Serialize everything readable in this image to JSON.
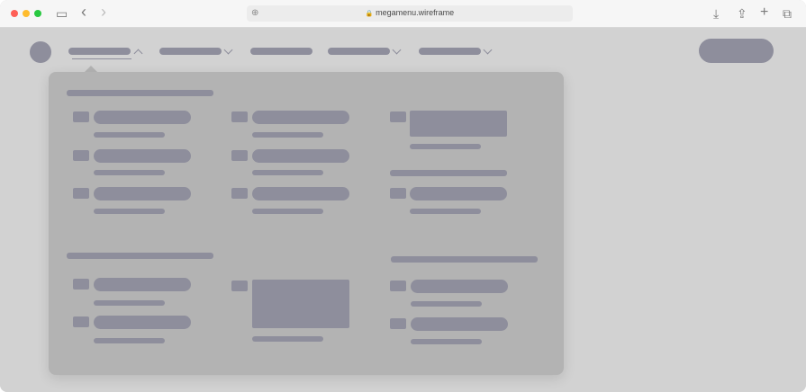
{
  "browser": {
    "url": "megamenu.wireframe",
    "nav_back": "‹",
    "nav_forward": "›",
    "lock_glyph": "🔒",
    "globe_glyph": "⊕",
    "download_glyph": "⤓",
    "share_glyph": "⇪",
    "new_tab_glyph": "+",
    "tabs_glyph": "⧉",
    "sidebar_glyph": "▭"
  },
  "colors": {
    "placeholder": "#8e8e9c",
    "panel": "#b3b3b3",
    "page_bg": "#d2d2d2",
    "close": "#fe5f57",
    "minimize": "#febc2e",
    "zoom": "#28c840"
  }
}
